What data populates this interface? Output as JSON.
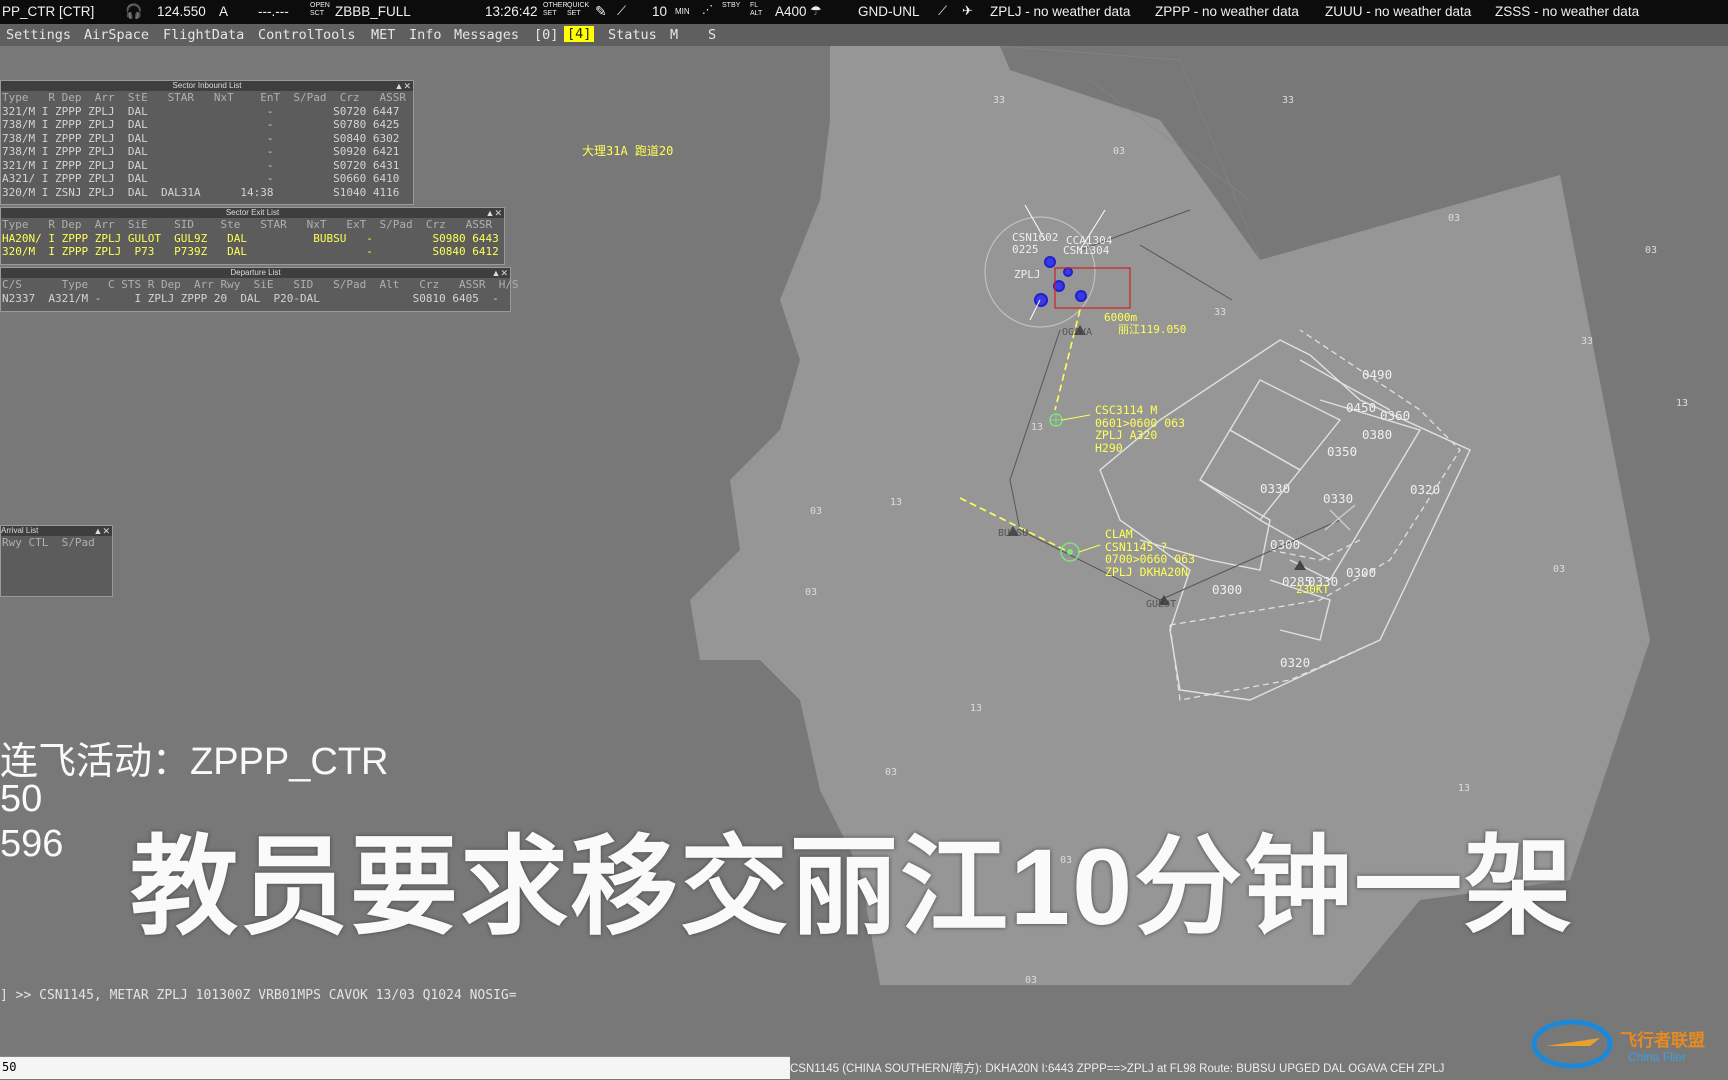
{
  "topbar": {
    "position": "PP_CTR [CTR]",
    "frequency": "124.550",
    "atis_code": "A",
    "secondary_freq": "---.---",
    "open_sct_label": "OPEN SCT",
    "sector_file": "ZBBB_FULL",
    "clock": "13:26:42",
    "other_set_label": "OTHER SET",
    "quick_set_label": "QUICK SET",
    "range_value": "10",
    "min_label": "MIN",
    "stby_label": "STBY",
    "fl_alt_label": "FL ALT",
    "altitude": "A400",
    "vertical_filter": "GND-UNL",
    "weather": [
      "ZPLJ - no weather data",
      "ZPPP - no weather data",
      "ZUUU - no weather data",
      "ZSSS - no weather data"
    ]
  },
  "menu": {
    "items": [
      "Settings",
      "AirSpace",
      "FlightData",
      "ControlTools",
      "MET",
      "Info",
      "Messages"
    ],
    "msg_count": "[0]",
    "highlight": "[4]",
    "status": "Status",
    "m": "M",
    "s": "S"
  },
  "sector_inbound": {
    "title": "Sector Inbound List",
    "header": "Type   R Dep  Arr  StE   STAR   NxT    EnT  S/Pad  Crz   ASSR",
    "rows": [
      "321/M I ZPPP ZPLJ  DAL                  -         S0720 6447",
      "738/M I ZPPP ZPLJ  DAL                  -         S0780 6425",
      "738/M I ZPPP ZPLJ  DAL                  -         S0840 6302",
      "738/M I ZPPP ZPLJ  DAL                  -         S0920 6421",
      "321/M I ZPPP ZPLJ  DAL                  -         S0720 6431",
      "A321/ I ZPPP ZPLJ  DAL                  -         S0660 6410",
      "320/M I ZSNJ ZPLJ  DAL  DAL31A      14:38         S1040 4116"
    ]
  },
  "sector_exit": {
    "title": "Sector Exit List",
    "header": "Type   R Dep  Arr  SiE    SID    Ste   STAR   NxT   ExT  S/Pad  Crz   ASSR",
    "rows": [
      "HA20N/ I ZPPP ZPLJ GULOT  GUL9Z   DAL          BUBSU   -         S0980 6443",
      "320/M  I ZPPP ZPLJ  P73   P739Z   DAL                  -         S0840 6412"
    ]
  },
  "departure_list": {
    "title": "Departure List",
    "header": "C/S      Type   C STS R Dep  Arr Rwy  SiE   SID   S/Pad  Alt   Crz   ASSR  H/S",
    "rows": [
      "N2337  A321/M -     I ZPLJ ZPPP 20  DAL  P20-DAL              S0810 6405  -"
    ]
  },
  "arrival_list": {
    "title": "Arrival List",
    "header": "Rwy CTL  S/Pad"
  },
  "map": {
    "procedure_note": "大理31A 跑道20",
    "sectors": [
      "0490",
      "0450",
      "0360",
      "0380",
      "0350",
      "0330",
      "0330",
      "0320",
      "0300",
      "0300",
      "0300",
      "0285",
      "0330",
      "0320"
    ],
    "speed_restriction": "230KT",
    "cluster_labels": [
      "CSN1602",
      "0225",
      "CCA1304",
      "CSN1304",
      "ZPLJ",
      "6000m",
      "丽江119.050"
    ],
    "fixes": [
      "OGAVA",
      "BUBSU",
      "GULOT"
    ],
    "tag1": {
      "line1": "CSC3114 M",
      "line2": "0601>0600 063",
      "line3": "ZPLJ A320",
      "line4": "H290"
    },
    "tag2": {
      "line1": "CLAM",
      "line2": "CSN1145 ?",
      "line3": "0700>0660 063",
      "line4": "ZPLJ DKHA20N"
    },
    "terrain_marks": [
      "33",
      "33",
      "03",
      "03",
      "03",
      "33",
      "33",
      "13",
      "13",
      "03",
      "13",
      "03",
      "03",
      "13",
      "03",
      "13",
      "03",
      "03"
    ]
  },
  "overlay": {
    "activity": "连飞活动：ZPPP_CTR",
    "num1": "50",
    "num2": "596",
    "subtitle": "教员要求移交丽江10分钟一架"
  },
  "command_line": "] >> CSN1145, METAR ZPLJ 101300Z VRB01MPS CAVOK 13/03 Q1024 NOSIG=",
  "input_value": "50",
  "status_info": "CSN1145 (CHINA SOUTHERN/南方): DKHA20N I:6443 ZPPP==>ZPLJ at FL98 Route: BUBSU UPGED DAL OGAVA CEH ZPLJ",
  "watermark": {
    "cn": "飞行者联盟",
    "en": "China Flier"
  },
  "colors": {
    "background": "#787878",
    "landmass": "#9a9a9a",
    "tag_yellow": "#ffff55",
    "topbar": "#0c0c0c"
  }
}
